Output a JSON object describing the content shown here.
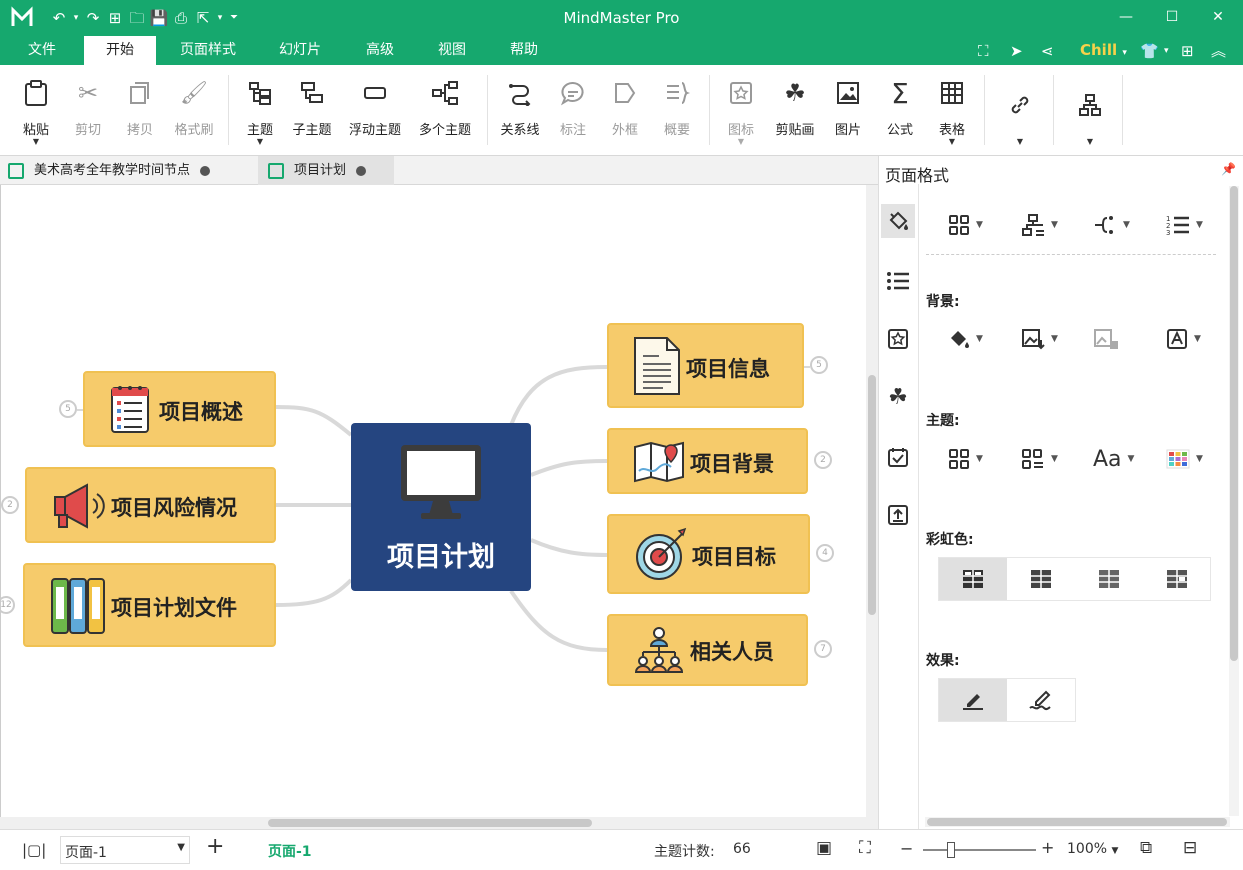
{
  "app": {
    "title": "MindMaster Pro"
  },
  "menu": {
    "items": [
      "文件",
      "开始",
      "页面样式",
      "幻灯片",
      "高级",
      "视图",
      "帮助"
    ],
    "active": "开始",
    "theme": "Chill"
  },
  "ribbon": {
    "paste": "粘贴",
    "cut": "剪切",
    "copy": "拷贝",
    "format_painter": "格式刷",
    "topic": "主题",
    "subtopic": "子主题",
    "floating_topic": "浮动主题",
    "multiple_topics": "多个主题",
    "relationship": "关系线",
    "callout": "标注",
    "boundary": "外框",
    "summary": "概要",
    "icon": "图标",
    "clipart": "剪贴画",
    "picture": "图片",
    "formula": "公式",
    "table": "表格"
  },
  "doc_tabs": [
    {
      "label": "美术高考全年教学时间节点"
    },
    {
      "label": "项目计划"
    }
  ],
  "mindmap": {
    "central": "项目计划",
    "left_nodes": [
      {
        "label": "项目概述",
        "count": "5",
        "icon": "checklist-icon"
      },
      {
        "label": "项目风险情况",
        "count": "2",
        "icon": "megaphone-icon"
      },
      {
        "label": "项目计划文件",
        "count": "12",
        "icon": "binders-icon"
      }
    ],
    "right_nodes": [
      {
        "label": "项目信息",
        "count": "5",
        "icon": "document-icon"
      },
      {
        "label": "项目背景",
        "count": "2",
        "icon": "map-icon"
      },
      {
        "label": "项目目标",
        "count": "4",
        "icon": "target-icon"
      },
      {
        "label": "相关人员",
        "count": "7",
        "icon": "people-icon"
      }
    ],
    "colors": {
      "central": "#254580",
      "node": "#f6cb6b",
      "connector": "#d9d9d9"
    }
  },
  "panel": {
    "title": "页面格式",
    "background_label": "背景:",
    "theme_label": "主题:",
    "rainbow_label": "彩虹色:",
    "effect_label": "效果:"
  },
  "status": {
    "page_select": "页面-1",
    "page_tab": "页面-1",
    "topic_count_label": "主题计数:",
    "topic_count": "66",
    "zoom": "100%",
    "zoom_level": 0.5
  },
  "colors": {
    "brand": "#16a86e",
    "theme_name": "#f6d24a"
  }
}
